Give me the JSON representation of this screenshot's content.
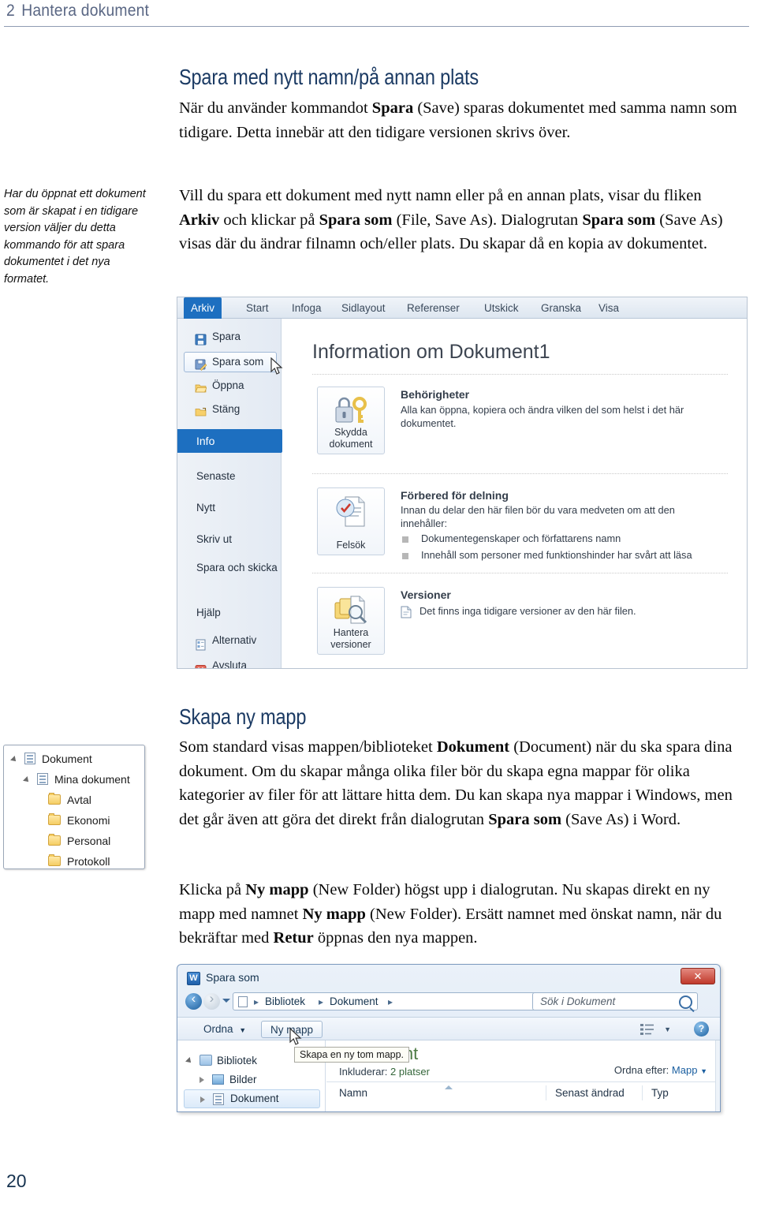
{
  "running_head": {
    "number": "2",
    "title": "Hantera dokument"
  },
  "folio": "20",
  "section1": {
    "heading": "Spara med nytt namn/på annan plats",
    "para1_a": "När du använder kommandot ",
    "para1_b": "Spara",
    "para1_c": " (Save) sparas dokumentet med samma namn som tidigare. Detta innebär att den tidigare versionen skrivs över.",
    "margin_note": "Har du öppnat ett dokument som är skapat i en tidigare version väljer du detta kommando för att spara dokumentet i det nya formatet.",
    "para2_a": "Vill du spara ett dokument med nytt namn eller på en annan plats, visar du fliken ",
    "para2_b": "Arkiv",
    "para2_c": " och klickar på ",
    "para2_d": "Spara som",
    "para2_e": " (File, Save As). Dialogrutan ",
    "para2_f": "Spara som",
    "para2_g": " (Save As) visas där du ändrar filnamn och/eller plats. Du skapar då en kopia av dokumentet."
  },
  "backstage": {
    "tabs": [
      {
        "label": "Arkiv",
        "active": true
      },
      {
        "label": "Start",
        "active": false
      },
      {
        "label": "Infoga",
        "active": false
      },
      {
        "label": "Sidlayout",
        "active": false
      },
      {
        "label": "Referenser",
        "active": false
      },
      {
        "label": "Utskick",
        "active": false
      },
      {
        "label": "Granska",
        "active": false
      },
      {
        "label": "Visa",
        "active": false
      }
    ],
    "nav": [
      {
        "label": "Spara",
        "icon": "save-icon"
      },
      {
        "label": "Spara som",
        "icon": "save-as-icon"
      },
      {
        "label": "Öppna",
        "icon": "open-folder-icon"
      },
      {
        "label": "Stäng",
        "icon": "close-folder-icon"
      },
      {
        "label": "Info",
        "icon": ""
      },
      {
        "label": "Senaste",
        "icon": ""
      },
      {
        "label": "Nytt",
        "icon": ""
      },
      {
        "label": "Skriv ut",
        "icon": ""
      },
      {
        "label": "Spara och skicka",
        "icon": ""
      },
      {
        "label": "Hjälp",
        "icon": ""
      },
      {
        "label": "Alternativ",
        "icon": "options-icon"
      },
      {
        "label": "Avsluta",
        "icon": "exit-icon"
      }
    ],
    "pane_title": "Information om Dokument1",
    "permissions": {
      "button_caption": "Skydda dokument",
      "heading": "Behörigheter",
      "text": "Alla kan öppna, kopiera och ändra vilken del som helst i det här dokumentet."
    },
    "share": {
      "button_caption": "Felsök",
      "heading": "Förbered för delning",
      "text": "Innan du delar den här filen bör du vara medveten om att den innehåller:",
      "items": [
        "Dokumentegenskaper och författarens namn",
        "Innehåll som personer med funktionshinder har svårt att läsa"
      ]
    },
    "versions": {
      "button_caption": "Hantera versioner",
      "heading": "Versioner",
      "text": "Det finns inga tidigare versioner av den här filen."
    }
  },
  "section2": {
    "heading": "Skapa ny mapp",
    "para1_a": "Som standard visas mappen/biblioteket ",
    "para1_b": "Dokument",
    "para1_c": " (Document) när du ska spara dina dokument. Om du skapar många olika filer bör du skapa egna mappar för olika kategorier av filer för att lättare hitta dem. Du kan skapa nya mappar i Windows, men det går även att göra det direkt från dialogrutan ",
    "para1_d": "Spara som",
    "para1_e": " (Save As) i Word.",
    "para2_a": "Klicka på ",
    "para2_b": "Ny mapp",
    "para2_c": " (New Folder) högst upp i dialogrutan. Nu skapas direkt en ny mapp med namnet ",
    "para2_d": "Ny mapp",
    "para2_e": " (New Folder). Ersätt namnet med önskat namn, när du bekräftar med ",
    "para2_f": "Retur",
    "para2_g": " öppnas den nya mappen."
  },
  "folder_tree": {
    "rows": [
      {
        "label": "Dokument",
        "icon": "document-library-icon",
        "indent": 0,
        "expander": "expanded"
      },
      {
        "label": "Mina dokument",
        "icon": "document-library-icon",
        "indent": 1,
        "expander": "expanded"
      },
      {
        "label": "Avtal",
        "icon": "folder-icon",
        "indent": 2,
        "expander": "none"
      },
      {
        "label": "Ekonomi",
        "icon": "folder-icon",
        "indent": 2,
        "expander": "none"
      },
      {
        "label": "Personal",
        "icon": "folder-icon",
        "indent": 2,
        "expander": "none"
      },
      {
        "label": "Protokoll",
        "icon": "folder-icon",
        "indent": 2,
        "expander": "none"
      }
    ]
  },
  "saveas_dialog": {
    "title": "Spara som",
    "app_icon_letter": "W",
    "close_label": "✕",
    "breadcrumb": [
      "Bibliotek",
      "Dokument"
    ],
    "search_placeholder": "Sök i Dokument",
    "toolbar": {
      "organize_label": "Ordna",
      "newfolder_label": "Ny mapp",
      "help_label": "?"
    },
    "tooltip": "Skapa en ny tom mapp.",
    "nav_tree": [
      {
        "label": "Bibliotek",
        "icon": "library-icon",
        "indent": 0,
        "expander": "expanded",
        "selected": false
      },
      {
        "label": "Bilder",
        "icon": "pictures-icon",
        "indent": 1,
        "expander": "collapsed",
        "selected": false
      },
      {
        "label": "Dokument",
        "icon": "document-library-icon",
        "indent": 1,
        "expander": "collapsed",
        "selected": true
      }
    ],
    "library_title": "Dokument",
    "library_sub_label": "Inkluderar:",
    "library_sub_value": "2 platser",
    "arrange_label": "Ordna efter:",
    "arrange_value": "Mapp",
    "columns": [
      "Namn",
      "Senast ändrad",
      "Typ"
    ]
  }
}
